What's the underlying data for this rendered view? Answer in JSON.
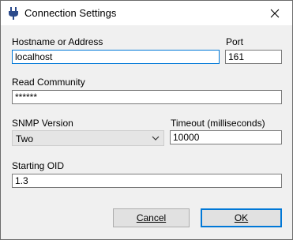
{
  "window": {
    "title": "Connection Settings"
  },
  "fields": {
    "hostname": {
      "label": "Hostname or Address",
      "value": "localhost"
    },
    "port": {
      "label": "Port",
      "value": "161"
    },
    "community": {
      "label": "Read Community",
      "value": "******"
    },
    "snmp_version": {
      "label": "SNMP Version",
      "value": "Two"
    },
    "timeout": {
      "label": "Timeout (milliseconds)",
      "value": "10000"
    },
    "starting_oid": {
      "label": "Starting OID",
      "value": "1.3"
    }
  },
  "buttons": {
    "cancel": "Cancel",
    "ok": "OK"
  },
  "colors": {
    "focus_border": "#0078d7",
    "dialog_bg": "#f0f0f0"
  }
}
